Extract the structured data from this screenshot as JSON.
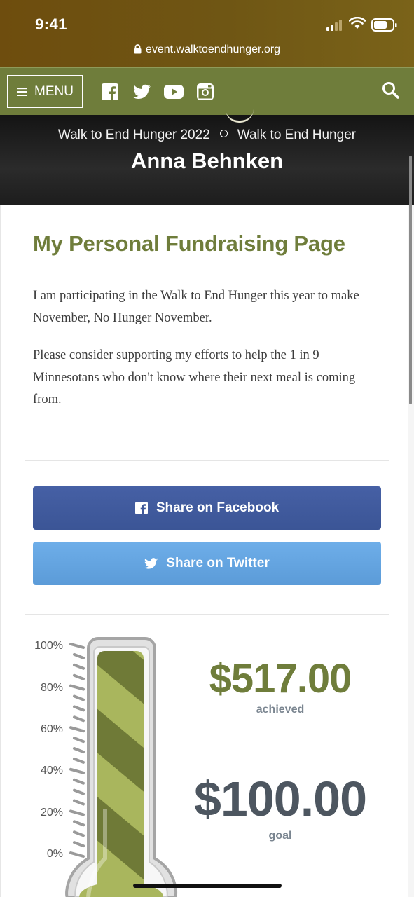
{
  "status_bar": {
    "time": "9:41",
    "url": "event.walktoendhunger.org"
  },
  "nav": {
    "menu_label": "MENU",
    "social_icons": [
      "facebook-icon",
      "twitter-icon",
      "youtube-icon",
      "instagram-icon"
    ],
    "search_icon": "search-icon"
  },
  "hero": {
    "event": "Walk to End Hunger 2022",
    "team": "Walk to End Hunger",
    "participant": "Anna Behnken"
  },
  "content": {
    "title": "My Personal Fundraising Page",
    "paragraphs": [
      "I am participating in the Walk to End Hunger this year to make November, No Hunger November.",
      "Please consider supporting my efforts to help the 1 in 9 Minnesotans who don't know where their next meal is coming from."
    ]
  },
  "share": {
    "facebook_label": "Share on Facebook",
    "twitter_label": "Share on Twitter"
  },
  "thermometer": {
    "scale_labels": [
      "100%",
      "80%",
      "60%",
      "40%",
      "20%",
      "0%"
    ],
    "fill_fraction": 1.0,
    "achieved_amount": "$517.00",
    "achieved_label": "achieved",
    "goal_amount": "$100.00",
    "goal_label": "goal"
  },
  "colors": {
    "brand_olive": "#6f7d3b",
    "facebook_blue": "#3b5596",
    "twitter_blue": "#5b9bd8",
    "goal_gray": "#4d5660"
  }
}
